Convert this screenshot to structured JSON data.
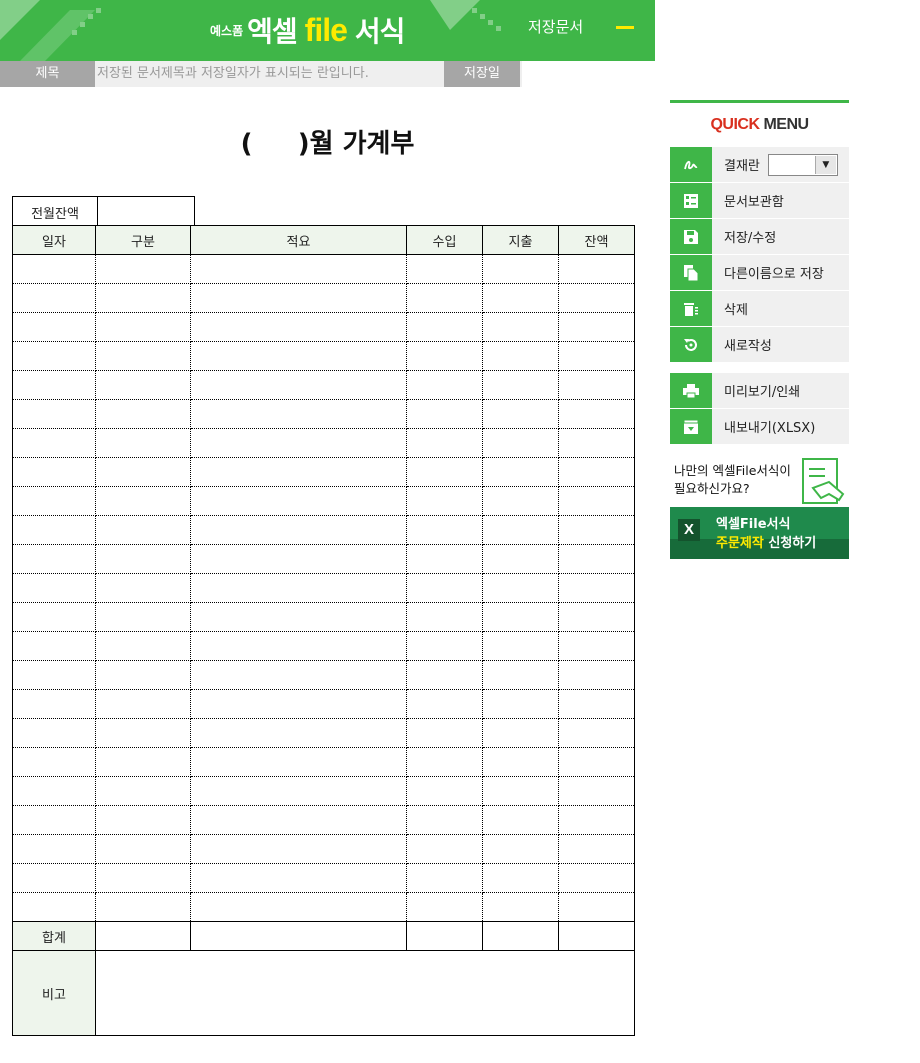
{
  "header": {
    "brand_yes": "예스폼",
    "brand_excel": "엑셀",
    "brand_file": "file",
    "brand_form": "서식",
    "saved_docs": "저장문서",
    "accent": "#3fb648"
  },
  "title_bar": {
    "title_label": "제목",
    "title_placeholder": "저장된 문서제목과 저장일자가 표시되는 란입니다.",
    "date_label": "저장일"
  },
  "ledger": {
    "title": "(     )월 가계부",
    "prev_balance_label": "전월잔액",
    "columns": [
      "일자",
      "구분",
      "적요",
      "수입",
      "지출",
      "잔액"
    ],
    "total_label": "합계",
    "note_label": "비고"
  },
  "quick_menu": {
    "title_quick": "QUICK",
    "title_menu": "MENU",
    "items": [
      {
        "label": "결재란",
        "icon": "signature-icon"
      },
      {
        "label": "문서보관함",
        "icon": "list-icon"
      },
      {
        "label": "저장/수정",
        "icon": "save-icon"
      },
      {
        "label": "다른이름으로 저장",
        "icon": "copy-icon"
      },
      {
        "label": "삭제",
        "icon": "trash-icon"
      },
      {
        "label": "새로작성",
        "icon": "refresh-icon"
      }
    ],
    "items2": [
      {
        "label": "미리보기/인쇄",
        "icon": "print-icon"
      },
      {
        "label": "내보내기(XLSX)",
        "icon": "export-icon"
      }
    ],
    "promo_line1": "나만의 엑셀File서식이",
    "promo_line2": "필요하신가요?",
    "order_x": "X",
    "order_line1": "엑셀File서식",
    "order_line2_highlight": "주문제작",
    "order_line2_rest": " 신청하기"
  }
}
